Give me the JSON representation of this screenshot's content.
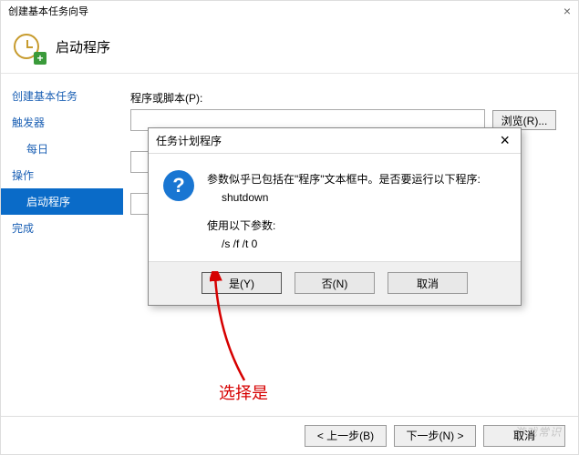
{
  "wizard": {
    "window_title": "创建基本任务向导",
    "close_glyph": "×",
    "header_title": "启动程序",
    "sidebar": {
      "create": "创建基本任务",
      "trigger": "触发器",
      "daily": "每日",
      "action": "操作",
      "start_program": "启动程序",
      "finish": "完成"
    },
    "form": {
      "program_label": "程序或脚本(P):",
      "browse": "浏览(R)..."
    },
    "footer": {
      "back": "< 上一步(B)",
      "next": "下一步(N) >",
      "cancel": "取消"
    }
  },
  "modal": {
    "title": "任务计划程序",
    "close_glyph": "×",
    "question_glyph": "?",
    "line1": "参数似乎已包括在\"程序\"文本框中。是否要运行以下程序:",
    "program": "shutdown",
    "line2": "使用以下参数:",
    "params": "/s /f /t 0",
    "yes": "是(Y)",
    "no": "否(N)",
    "cancel": "取消"
  },
  "annotation": {
    "text": "选择是"
  },
  "watermark": "游戏常识"
}
